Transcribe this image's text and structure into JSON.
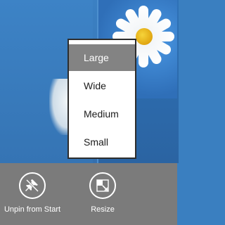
{
  "context_menu": {
    "items": [
      {
        "label": "Large",
        "selected": true
      },
      {
        "label": "Wide",
        "selected": false
      },
      {
        "label": "Medium",
        "selected": false
      },
      {
        "label": "Small",
        "selected": false
      }
    ]
  },
  "app_bar": {
    "commands": [
      {
        "label": "Unpin from Start",
        "icon": "unpin-icon"
      },
      {
        "label": "Resize",
        "icon": "resize-icon"
      }
    ]
  },
  "colors": {
    "menu_selected": "#838383",
    "app_bar": "#7b7b7b",
    "background": "#3a7fc0"
  }
}
